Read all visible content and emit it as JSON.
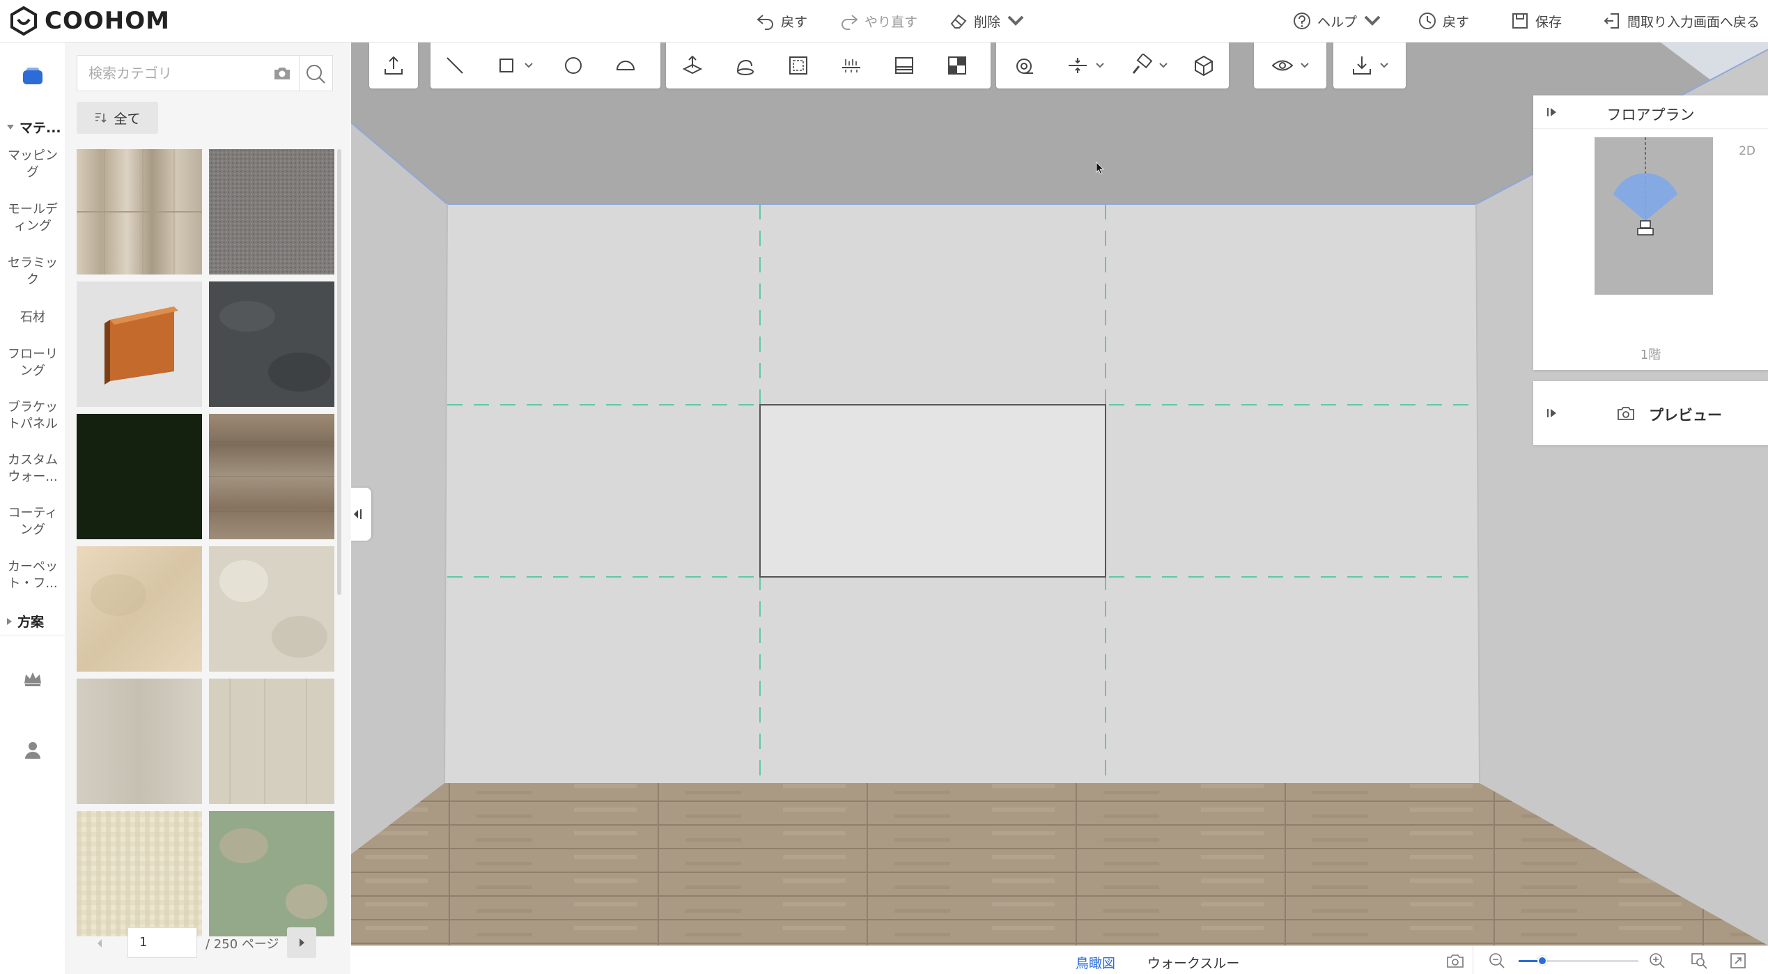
{
  "app": {
    "brand": "COOHOM",
    "accent_color": "#2b6cd6"
  },
  "topbar": {
    "undo": "戻す",
    "redo": "やり直す",
    "delete": "削除",
    "help": "ヘルプ",
    "history": "戻す",
    "save": "保存",
    "back_to_floorplan": "間取り入力画面へ戻る"
  },
  "rail": {
    "section_materials": "マテ...",
    "items": [
      {
        "label": "マッピング"
      },
      {
        "label": "モールディング"
      },
      {
        "label": "セラミック"
      },
      {
        "label": "石材"
      },
      {
        "label": "フローリング"
      },
      {
        "label": "ブラケットパネル"
      },
      {
        "label": "カスタムウォー..."
      },
      {
        "label": "コーティング"
      },
      {
        "label": "カーペット・フ..."
      }
    ],
    "section_plans": "方案"
  },
  "catalog": {
    "search_placeholder": "検索カテゴリ",
    "filter_label": "全て",
    "swatches": [
      {
        "name": "light-wood-plank",
        "color": "#cfc3b0"
      },
      {
        "name": "gray-carpet",
        "color": "#7d7b79"
      },
      {
        "name": "wood-baseboard-molding",
        "color": "#c36a2c"
      },
      {
        "name": "dark-slate-stone",
        "color": "#494c4f"
      },
      {
        "name": "dark-green-solid",
        "color": "#15210f"
      },
      {
        "name": "weathered-brown-wood",
        "color": "#8c7a66"
      },
      {
        "name": "beige-blotched-coating",
        "color": "#e2d2b7"
      },
      {
        "name": "cream-mottled-tile",
        "color": "#d8d3c4"
      },
      {
        "name": "pale-gray-wood",
        "color": "#cdc8bb"
      },
      {
        "name": "pale-beige-wood",
        "color": "#d4cfbf"
      },
      {
        "name": "cream-check-fabric",
        "color": "#e6e0c8"
      },
      {
        "name": "green-mottled-coating",
        "color": "#93a98a"
      }
    ],
    "page_current": "1",
    "page_total": "/ 250 ページ"
  },
  "toolbar": {
    "groups": [
      [
        "upload-icon"
      ],
      [
        "line-icon",
        "rectangle-icon",
        "circle-icon",
        "arc-icon"
      ],
      [
        "extrude-icon",
        "sweep-icon",
        "frame-select-icon",
        "align-icon",
        "panel-icon",
        "layout-icon"
      ],
      [
        "measure-icon",
        "divide-icon",
        "material-brush-icon",
        "model-icon"
      ],
      [
        "view-icon"
      ],
      [
        "download-icon"
      ]
    ]
  },
  "floorplan_panel": {
    "title": "フロアプラン",
    "mode": "2D",
    "floor": "1階"
  },
  "preview_panel": {
    "title": "プレビュー"
  },
  "statusbar": {
    "birdseye": "鳥瞰図",
    "walkthrough": "ウォークスルー",
    "zoom_level": 0.2
  },
  "scene": {
    "ceiling_color": "#a9a9a9",
    "back_wall_color": "#d9d9d9",
    "side_wall_color": "#c6c6c6",
    "floor_color": "#aa9a84",
    "guide_color": "#5fc9a6",
    "edge_color": "#8fa8d8"
  }
}
